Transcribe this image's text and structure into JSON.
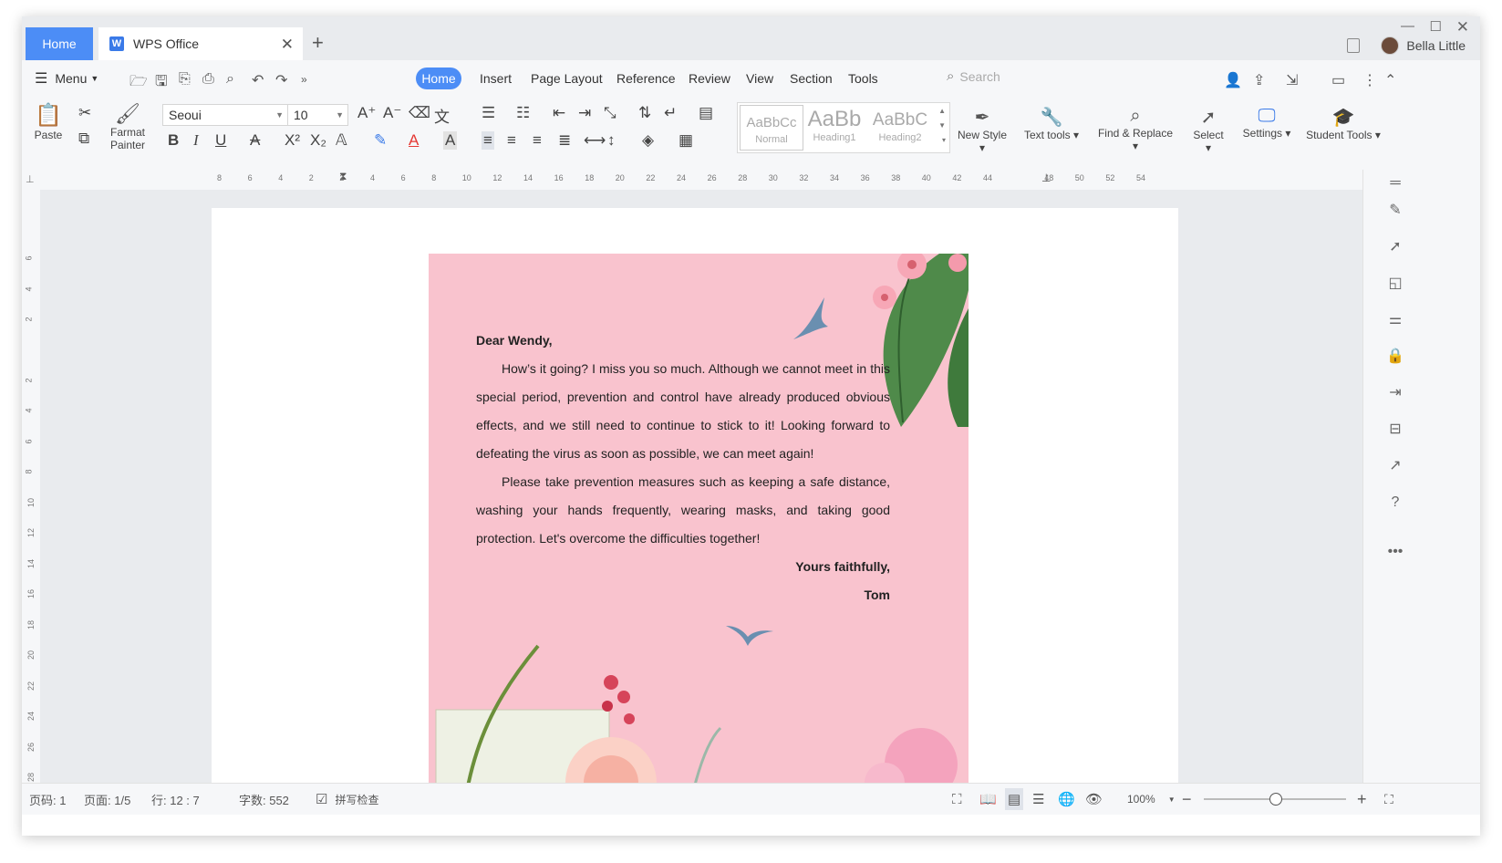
{
  "titlebar": {
    "home_tab": "Home",
    "doc_tab": "WPS Office",
    "user_name": "Bella Little"
  },
  "menubar": {
    "menu_label": "Menu",
    "tabs": [
      "Home",
      "Insert",
      "Page Layout",
      "Reference",
      "Review",
      "View",
      "Section",
      "Tools"
    ],
    "search_placeholder": "Search"
  },
  "ribbon": {
    "paste": "Paste",
    "format_painter_1": "Farmat",
    "format_painter_2": "Painter",
    "font_name": "Seoui",
    "font_size": "10",
    "styles": {
      "normal_preview": "AaBbCc",
      "normal_label": "Normal",
      "h1_preview": "AaBb",
      "h1_label": "Heading1",
      "h2_preview": "AaBbC",
      "h2_label": "Heading2"
    },
    "new_style": "New Style",
    "text_tools": "Text tools",
    "find_replace": "Find & Replace",
    "select": "Select",
    "settings": "Settings",
    "student_tools": "Student Tools"
  },
  "ruler": {
    "h_ticks": [
      "8",
      "6",
      "4",
      "2",
      "2",
      "4",
      "6",
      "8",
      "10",
      "12",
      "14",
      "16",
      "18",
      "20",
      "22",
      "24",
      "26",
      "28",
      "30",
      "32",
      "34",
      "36",
      "38",
      "40",
      "42",
      "44",
      "48",
      "50",
      "52",
      "54"
    ],
    "v_ticks": [
      "6",
      "4",
      "2",
      "2",
      "4",
      "6",
      "8",
      "10",
      "12",
      "14",
      "16",
      "18",
      "20",
      "22",
      "24",
      "26",
      "28"
    ]
  },
  "letter": {
    "greeting": "Dear Wendy,",
    "para1": "How’s it going? I miss you so much. Although we cannot meet in this special period, prevention and control have already produced obvious effects, and we still need to continue to stick to it! Looking forward to defeating the virus as soon as possible, we can meet again!",
    "para2": "Please take prevention measures such as keeping a safe distance, washing your hands frequently, wearing masks, and taking good protection. Let's overcome the difficulties together!",
    "closing": "Yours faithfully,",
    "signature": "Tom"
  },
  "statusbar": {
    "page_code": "页码: 1",
    "pages": "页面: 1/5",
    "row_col": "行: 12 : 7",
    "word_count": "字数: 552",
    "spell_check": "拼写检查",
    "zoom": "100%",
    "zoom_level": 0.5
  },
  "colors": {
    "accent": "#4c8df6",
    "letter_bg": "#f9c3ce",
    "leaf": "#4f8a4a"
  }
}
